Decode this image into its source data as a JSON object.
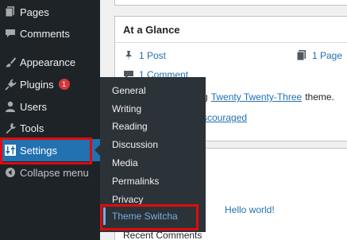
{
  "menu": {
    "pages": "Pages",
    "comments": "Comments",
    "appearance": "Appearance",
    "plugins": "Plugins",
    "plugins_badge": "1",
    "users": "Users",
    "tools": "Tools",
    "settings": "Settings",
    "collapse": "Collapse menu"
  },
  "settings_submenu": {
    "general": "General",
    "writing": "Writing",
    "reading": "Reading",
    "discussion": "Discussion",
    "media": "Media",
    "permalinks": "Permalinks",
    "privacy": "Privacy",
    "theme_switcha": "Theme Switcha"
  },
  "glance": {
    "title": "At a Glance",
    "posts": "1 Post",
    "pages": "1 Page",
    "comments": "1 Comment",
    "theme_text_prefix": "g",
    "theme_link": "Twenty Twenty-Three",
    "theme_text_suffix": "theme.",
    "search_discouraged": "scouraged"
  },
  "activity": {
    "hello": "Hello world!",
    "recent_comments": "Recent Comments"
  },
  "colors": {
    "admin_bg": "#1d2327",
    "submenu_bg": "#2c3338",
    "accent": "#2271b1",
    "highlight": "#e00b0b"
  }
}
